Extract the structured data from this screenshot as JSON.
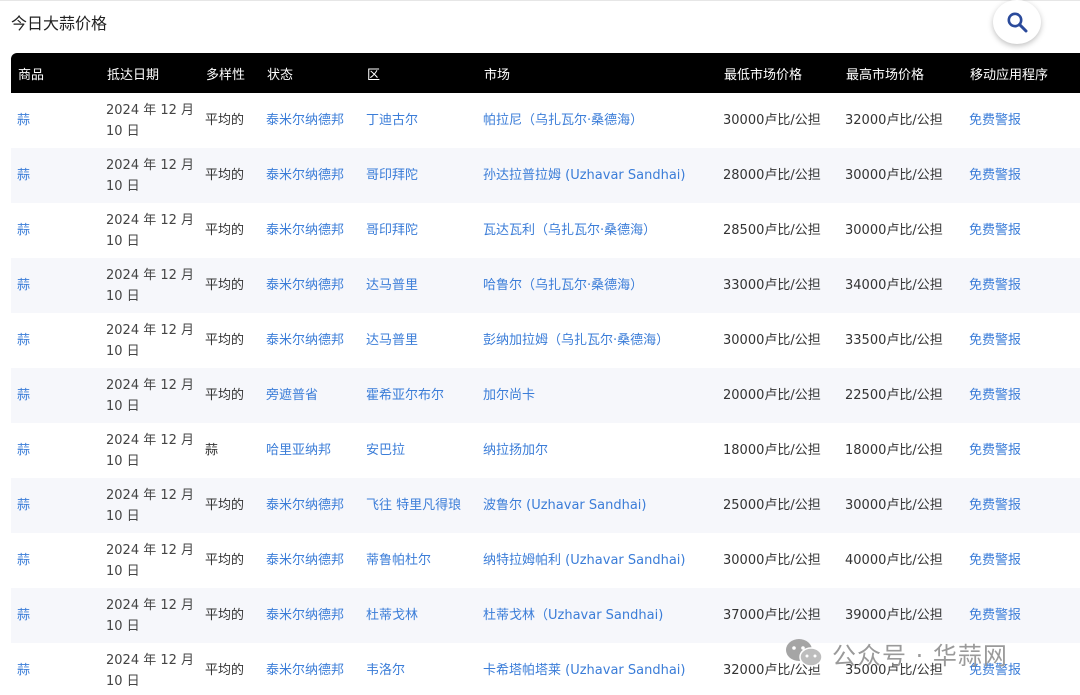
{
  "page": {
    "title": "今日大蒜价格"
  },
  "search": {
    "icon": "search-icon"
  },
  "table": {
    "headers": [
      "商品",
      "抵达日期",
      "多样性",
      "状态",
      "区",
      "市场",
      "最低市场价格",
      "最高市场价格",
      "移动应用程序"
    ],
    "rows": [
      {
        "commodity": "蒜",
        "date_line1": "2024 年 12 月",
        "date_line2": "10 日",
        "variety": "平均的",
        "state": "泰米尔纳德邦",
        "district": "丁迪古尔",
        "market": "帕拉尼（乌扎瓦尔·桑德海）",
        "min_price": "30000卢比/公担",
        "max_price": "32000卢比/公担",
        "app": "免费警报"
      },
      {
        "commodity": "蒜",
        "date_line1": "2024 年 12 月",
        "date_line2": "10 日",
        "variety": "平均的",
        "state": "泰米尔纳德邦",
        "district": "哥印拜陀",
        "market": "孙达拉普拉姆 (Uzhavar Sandhai)",
        "min_price": "28000卢比/公担",
        "max_price": "30000卢比/公担",
        "app": "免费警报"
      },
      {
        "commodity": "蒜",
        "date_line1": "2024 年 12 月",
        "date_line2": "10 日",
        "variety": "平均的",
        "state": "泰米尔纳德邦",
        "district": "哥印拜陀",
        "market": "瓦达瓦利（乌扎瓦尔·桑德海）",
        "min_price": "28500卢比/公担",
        "max_price": "30000卢比/公担",
        "app": "免费警报"
      },
      {
        "commodity": "蒜",
        "date_line1": "2024 年 12 月",
        "date_line2": "10 日",
        "variety": "平均的",
        "state": "泰米尔纳德邦",
        "district": "达马普里",
        "market": "哈鲁尔（乌扎瓦尔·桑德海）",
        "min_price": "33000卢比/公担",
        "max_price": "34000卢比/公担",
        "app": "免费警报"
      },
      {
        "commodity": "蒜",
        "date_line1": "2024 年 12 月",
        "date_line2": "10 日",
        "variety": "平均的",
        "state": "泰米尔纳德邦",
        "district": "达马普里",
        "market": "彭纳加拉姆（乌扎瓦尔·桑德海）",
        "min_price": "30000卢比/公担",
        "max_price": "33500卢比/公担",
        "app": "免费警报"
      },
      {
        "commodity": "蒜",
        "date_line1": "2024 年 12 月",
        "date_line2": "10 日",
        "variety": "平均的",
        "state": "旁遮普省",
        "district": "霍希亚尔布尔",
        "market": "加尔尚卡",
        "min_price": "20000卢比/公担",
        "max_price": "22500卢比/公担",
        "app": "免费警报"
      },
      {
        "commodity": "蒜",
        "date_line1": "2024 年 12 月",
        "date_line2": "10 日",
        "variety": "蒜",
        "state": "哈里亚纳邦",
        "district": "安巴拉",
        "market": "纳拉扬加尔",
        "min_price": "18000卢比/公担",
        "max_price": "18000卢比/公担",
        "app": "免费警报"
      },
      {
        "commodity": "蒜",
        "date_line1": "2024 年 12 月",
        "date_line2": "10 日",
        "variety": "平均的",
        "state": "泰米尔纳德邦",
        "district": "飞往 特里凡得琅",
        "market": "波鲁尔 (Uzhavar Sandhai)",
        "min_price": "25000卢比/公担",
        "max_price": "30000卢比/公担",
        "app": "免费警报"
      },
      {
        "commodity": "蒜",
        "date_line1": "2024 年 12 月",
        "date_line2": "10 日",
        "variety": "平均的",
        "state": "泰米尔纳德邦",
        "district": "蒂鲁帕杜尔",
        "market": "纳特拉姆帕利 (Uzhavar Sandhai)",
        "min_price": "30000卢比/公担",
        "max_price": "40000卢比/公担",
        "app": "免费警报"
      },
      {
        "commodity": "蒜",
        "date_line1": "2024 年 12 月",
        "date_line2": "10 日",
        "variety": "平均的",
        "state": "泰米尔纳德邦",
        "district": "杜蒂戈林",
        "market": "杜蒂戈林（Uzhavar Sandhai)",
        "min_price": "37000卢比/公担",
        "max_price": "39000卢比/公担",
        "app": "免费警报"
      },
      {
        "commodity": "蒜",
        "date_line1": "2024 年 12 月",
        "date_line2": "10 日",
        "variety": "平均的",
        "state": "泰米尔纳德邦",
        "district": "韦洛尔",
        "market": "卡希塔帕塔莱 (Uzhavar Sandhai)",
        "min_price": "32000卢比/公担",
        "max_price": "35000卢比/公担",
        "app": "免费警报"
      }
    ]
  },
  "watermark": {
    "text": "公众号 · 华蒜网",
    "icon": "wechat-icon"
  }
}
